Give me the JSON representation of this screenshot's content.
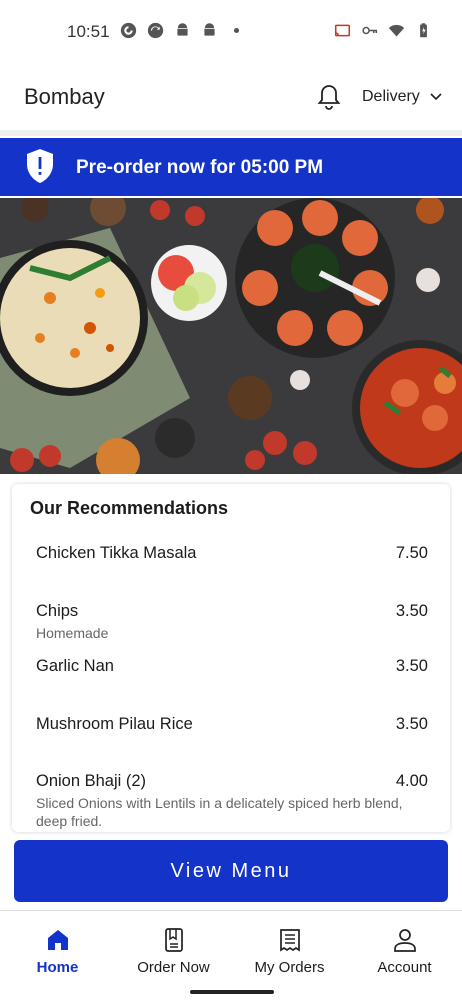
{
  "status_bar": {
    "time": "10:51",
    "left_icons": [
      "pocketcasts-icon",
      "sync-icon",
      "android-icon",
      "android-icon",
      "dot-icon"
    ],
    "right_icons": [
      "cast-icon",
      "vpn-key-icon",
      "wifi-icon",
      "battery-icon"
    ]
  },
  "header": {
    "restaurant_name": "Bombay",
    "notification_icon": "bell-icon",
    "order_mode": "Delivery"
  },
  "banner": {
    "icon": "shield-alert-icon",
    "text": "Pre-order now for 05:00 PM",
    "color": "#1433c8"
  },
  "hero": {
    "description_icon": "food-hero-image"
  },
  "recommendations": {
    "title": "Our Recommendations",
    "items": [
      {
        "name": "Chicken Tikka Masala",
        "price": "7.50",
        "desc": ""
      },
      {
        "name": "Chips",
        "price": "3.50",
        "desc": "Homemade"
      },
      {
        "name": "Garlic Nan",
        "price": "3.50",
        "desc": ""
      },
      {
        "name": "Mushroom Pilau Rice",
        "price": "3.50",
        "desc": ""
      },
      {
        "name": "Onion Bhaji (2)",
        "price": "4.00",
        "desc": "Sliced Onions with Lentils in a delicately spiced herb blend, deep fried."
      }
    ]
  },
  "cta": {
    "label": "View Menu"
  },
  "bottom_nav": {
    "items": [
      {
        "label": "Home",
        "icon": "home-icon",
        "active": true
      },
      {
        "label": "Order Now",
        "icon": "menu-book-icon",
        "active": false
      },
      {
        "label": "My Orders",
        "icon": "receipt-icon",
        "active": false
      },
      {
        "label": "Account",
        "icon": "person-icon",
        "active": false
      }
    ]
  },
  "colors": {
    "accent": "#1433c8",
    "text": "#1c1c1c"
  }
}
